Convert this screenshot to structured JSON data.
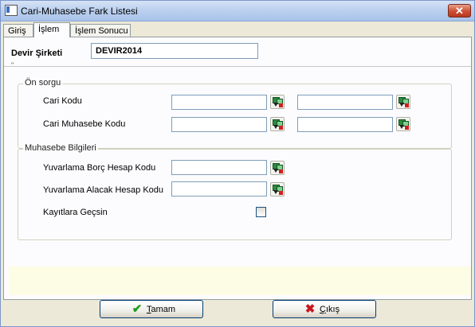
{
  "window": {
    "title": "Cari-Muhasebe Fark Listesi",
    "close_glyph": "✕"
  },
  "tabs": [
    {
      "label": "Giriş"
    },
    {
      "label": "İşlem"
    },
    {
      "label": "İşlem Sonucu"
    }
  ],
  "active_tab": "İşlem",
  "header": {
    "company_label": "Devir Şirketi",
    "company_value": "DEVIR2014",
    "marker": "\""
  },
  "on_sorgu": {
    "title": "Ön sorgu",
    "rows": [
      {
        "label": "Cari Kodu",
        "from_value": "",
        "to_value": ""
      },
      {
        "label": "Cari Muhasebe Kodu",
        "from_value": "",
        "to_value": ""
      }
    ]
  },
  "muhasebe": {
    "title": "Muhasebe Bilgileri",
    "rows": [
      {
        "label": "Yuvarlama Borç Hesap Kodu",
        "value": ""
      },
      {
        "label": "Yuvarlama Alacak Hesap Kodu",
        "value": ""
      }
    ],
    "checkbox_label": "Kayıtlara Geçsin",
    "checkbox_checked": false
  },
  "buttons": {
    "ok": {
      "mnemonic": "T",
      "rest": "amam",
      "icon": "checkmark-icon",
      "color": "#1e9b1e"
    },
    "exit": {
      "mnemonic": "Ç",
      "rest": "ıkış",
      "icon": "x-icon",
      "color": "#c8181e"
    }
  },
  "colors": {
    "titlebar": "#bcd1ef",
    "field_border": "#7f9db9",
    "status_area": "#fdfde6"
  },
  "icons": {
    "app": "form-icon",
    "lookup": "lookup-icon",
    "close": "close-icon"
  }
}
